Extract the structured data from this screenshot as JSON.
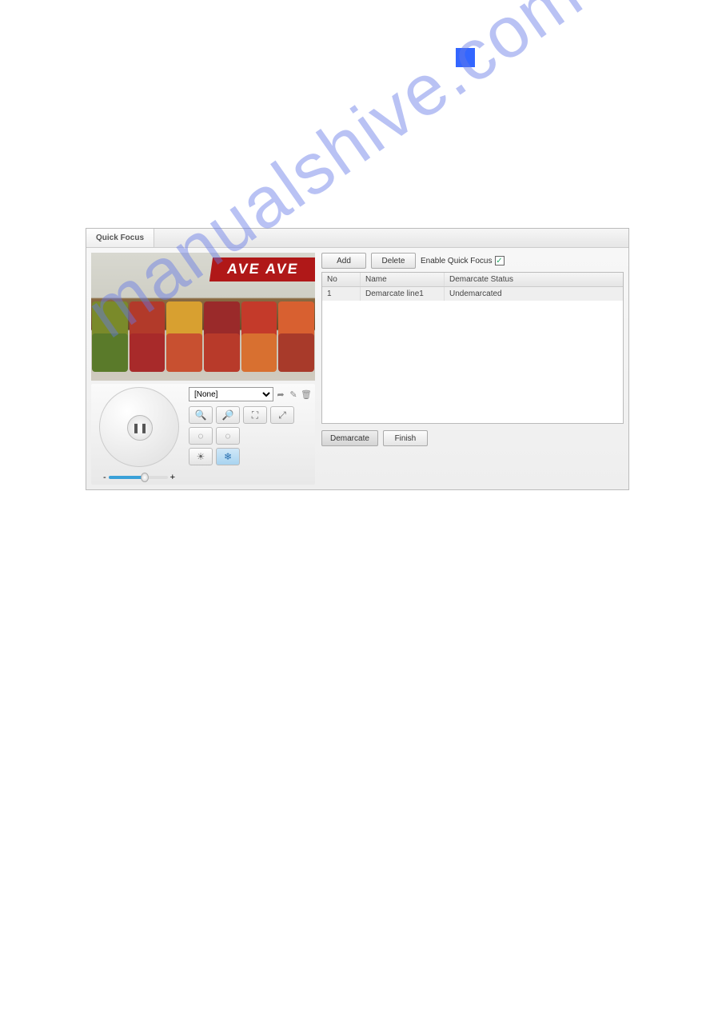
{
  "tab_label": "Quick Focus",
  "video": {
    "sign_text": "AVE AVE"
  },
  "ptz": {
    "preset_selected": "[None]",
    "slider_minus": "-",
    "slider_plus": "+"
  },
  "toolbar": {
    "add_label": "Add",
    "delete_label": "Delete",
    "enable_label": "Enable Quick Focus",
    "enable_checked": "✓"
  },
  "table": {
    "headers": {
      "no": "No",
      "name": "Name",
      "status": "Demarcate Status"
    },
    "rows": [
      {
        "no": "1",
        "name": "Demarcate line1",
        "status": "Undemarcated"
      }
    ]
  },
  "actions": {
    "demarcate_label": "Demarcate",
    "finish_label": "Finish"
  }
}
